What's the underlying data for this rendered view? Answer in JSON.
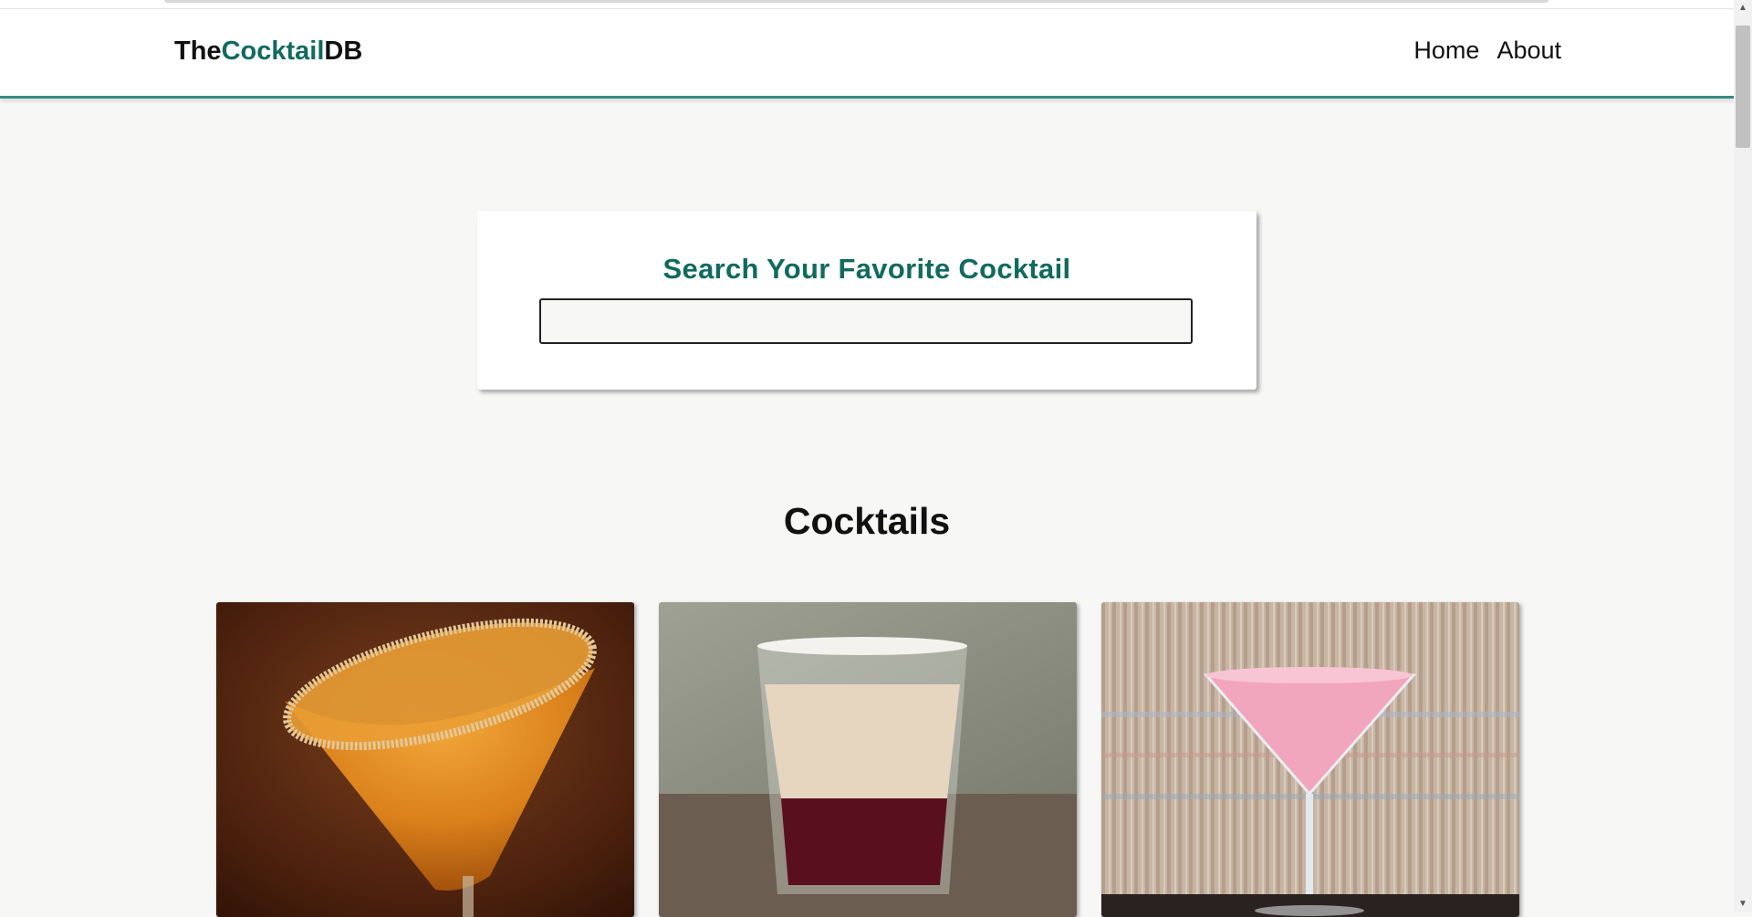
{
  "navbar": {
    "logo_prefix": "The",
    "logo_accent": "Cocktail",
    "logo_suffix": "DB",
    "links": [
      {
        "label": "Home"
      },
      {
        "label": "About"
      }
    ]
  },
  "search": {
    "title": "Search Your Favorite Cocktail",
    "value": ""
  },
  "cocktails": {
    "heading": "Cocktails"
  },
  "colors": {
    "accent": "#116a5f",
    "navbar_border": "#3b8a80",
    "page_background": "#f7f8f6"
  }
}
